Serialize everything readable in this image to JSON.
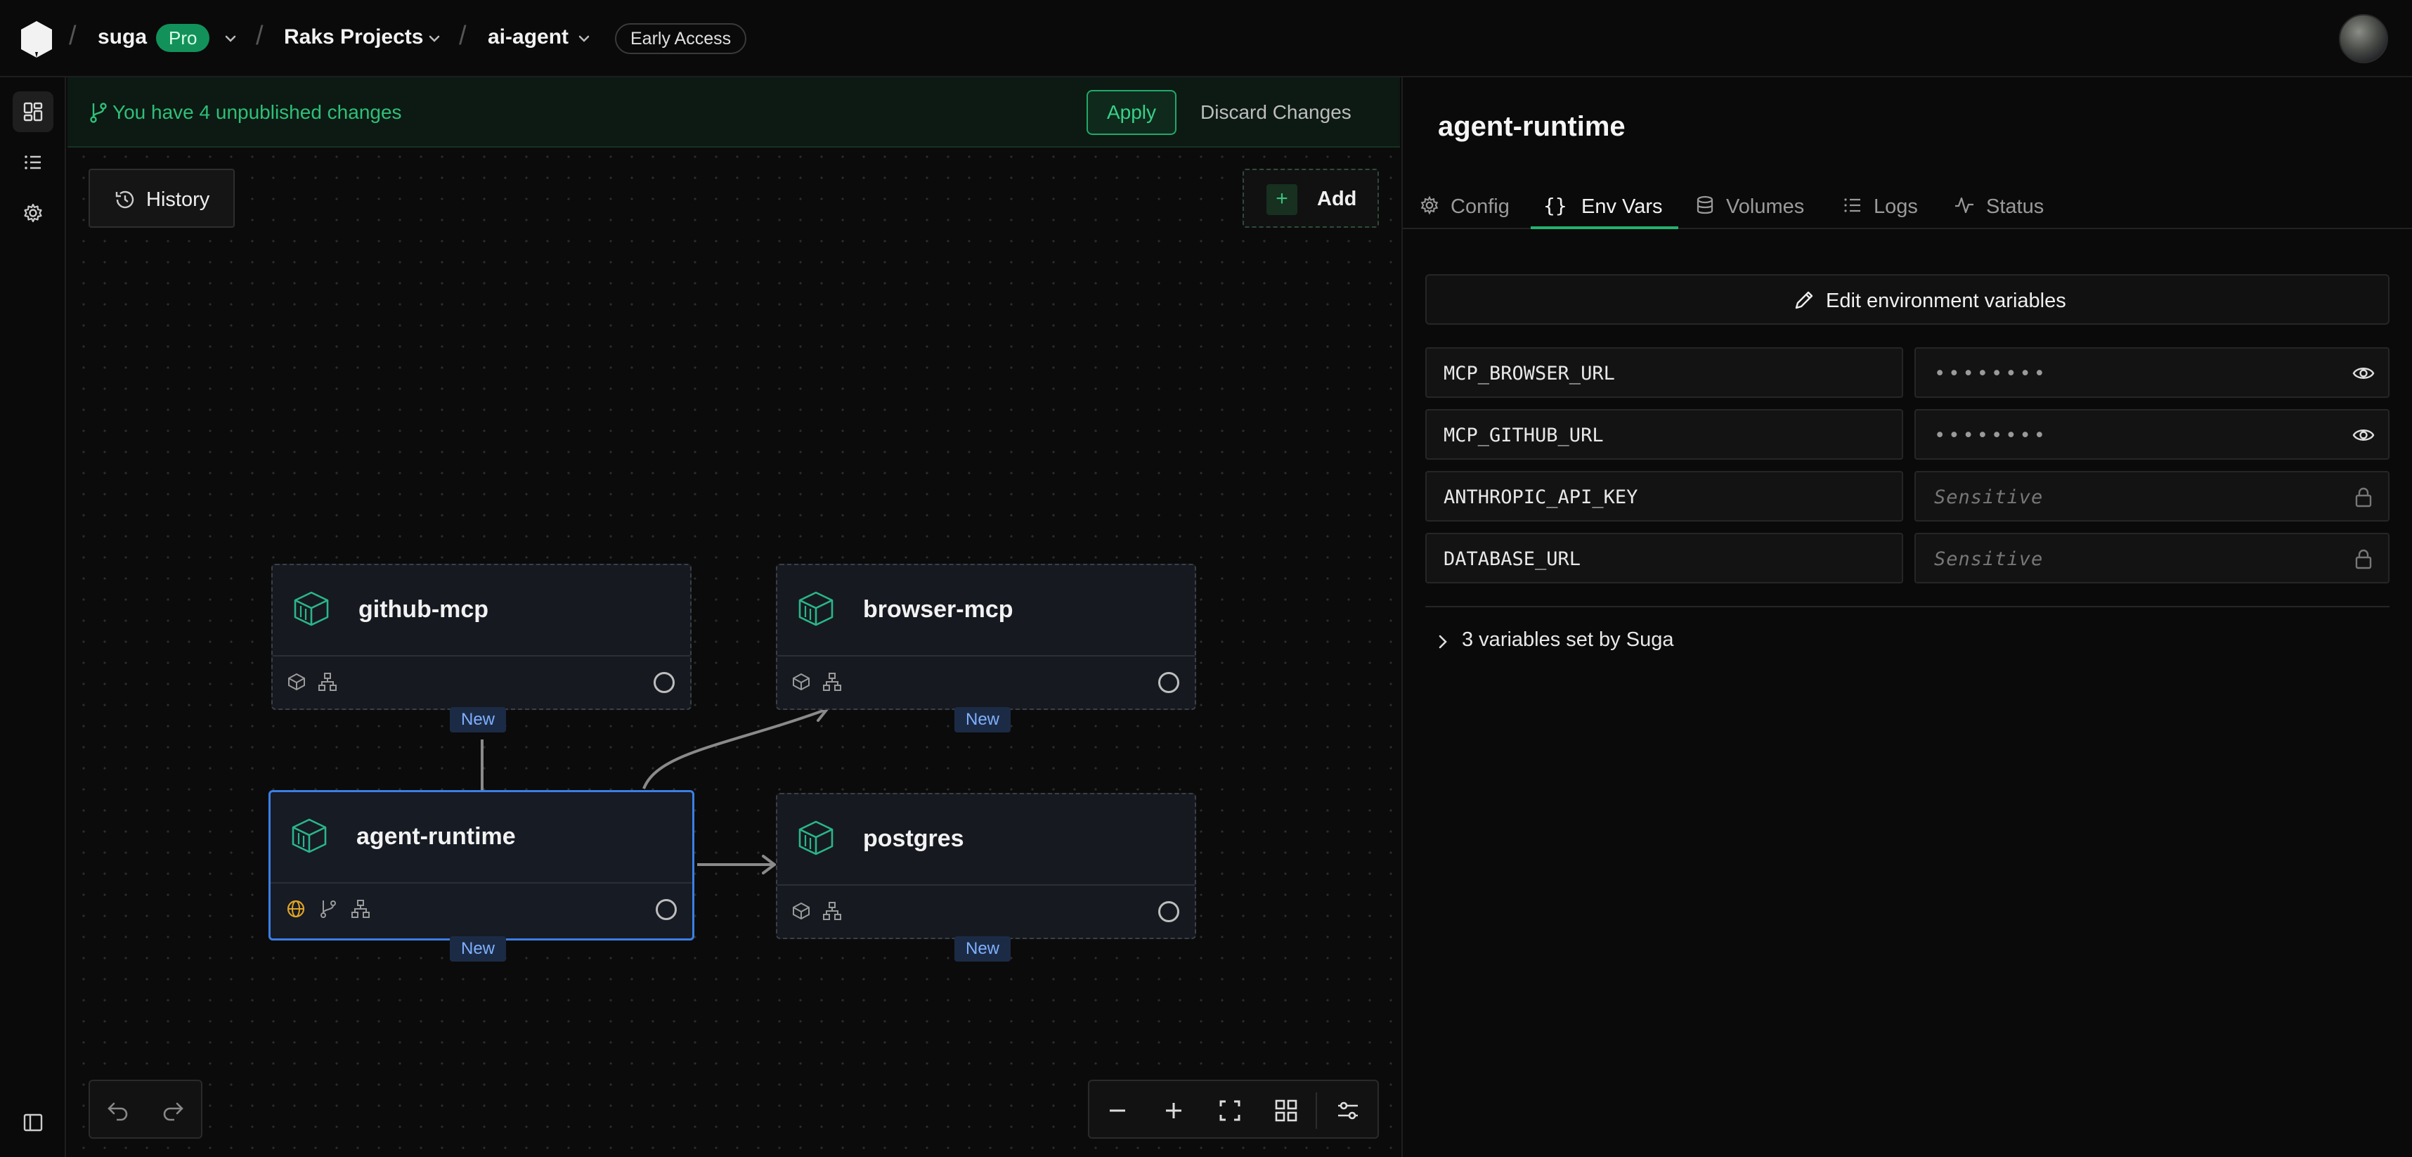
{
  "header": {
    "org": "suga",
    "plan_badge": "Pro",
    "project": "Raks Projects",
    "environment": "ai-agent",
    "early_access_badge": "Early Access",
    "icons": [
      "logo-icon",
      "chevron-down-icon",
      "avatar"
    ]
  },
  "sidebar": {
    "items": [
      {
        "name": "dashboard-icon",
        "active": true
      },
      {
        "name": "list-icon",
        "active": false
      },
      {
        "name": "gear-icon",
        "active": false
      }
    ],
    "bottom_icon": "sidebar-toggle-icon"
  },
  "canvas": {
    "changes_banner": "You have 4 unpublished changes",
    "apply_label": "Apply",
    "discard_label": "Discard Changes",
    "history_label": "History",
    "add_label": "Add",
    "nodes": [
      {
        "id": "github-mcp",
        "title": "github-mcp",
        "tag": "New",
        "selected": false
      },
      {
        "id": "browser-mcp",
        "title": "browser-mcp",
        "tag": "New",
        "selected": false
      },
      {
        "id": "agent-runtime",
        "title": "agent-runtime",
        "tag": "New",
        "selected": true
      },
      {
        "id": "postgres",
        "title": "postgres",
        "tag": "New",
        "selected": false
      }
    ],
    "edges": [
      {
        "from": "agent-runtime",
        "to": "github-mcp"
      },
      {
        "from": "agent-runtime",
        "to": "browser-mcp"
      },
      {
        "from": "agent-runtime",
        "to": "postgres"
      }
    ],
    "controls": [
      "undo-icon",
      "redo-icon",
      "zoom-out-icon",
      "zoom-in-icon",
      "fit-view-icon",
      "grid-icon",
      "settings-sliders-icon"
    ]
  },
  "panel": {
    "title": "agent-runtime",
    "tabs": [
      {
        "label": "Config",
        "icon": "gear-icon",
        "active": false
      },
      {
        "label": "Env Vars",
        "icon": "braces-icon",
        "active": true
      },
      {
        "label": "Volumes",
        "icon": "database-icon",
        "active": false
      },
      {
        "label": "Logs",
        "icon": "list-icon",
        "active": false
      },
      {
        "label": "Status",
        "icon": "activity-icon",
        "active": false
      }
    ],
    "edit_label": "Edit environment variables",
    "env_vars": [
      {
        "key": "MCP_BROWSER_URL",
        "value": "••••••••",
        "trailing_icon": "eye-icon"
      },
      {
        "key": "MCP_GITHUB_URL",
        "value": "••••••••",
        "trailing_icon": "eye-icon"
      },
      {
        "key": "ANTHROPIC_API_KEY",
        "value": "Sensitive",
        "trailing_icon": "lock-icon"
      },
      {
        "key": "DATABASE_URL",
        "value": "Sensitive",
        "trailing_icon": "lock-icon"
      }
    ],
    "suga_vars_label": "3 variables set by Suga"
  },
  "colors": {
    "accent_green": "#22b26e",
    "selected_blue": "#3b7fe6",
    "node_icon_teal": "#2bb58a",
    "globe_amber": "#e0a426"
  }
}
